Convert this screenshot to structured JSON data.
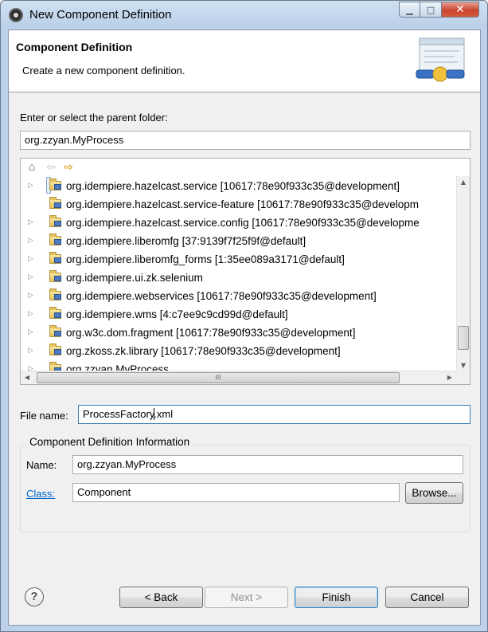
{
  "window": {
    "title": "New Component Definition"
  },
  "banner": {
    "title": "Component Definition",
    "description": "Create a new component definition."
  },
  "parent_folder": {
    "label": "Enter or select the parent folder:",
    "value": "org.zzyan.MyProcess"
  },
  "tree": {
    "items": [
      {
        "label": "org.idempiere.hazelcast.service [10617:78e90f933c35@development]",
        "expandable": true,
        "selected": true
      },
      {
        "label": "org.idempiere.hazelcast.service-feature [10617:78e90f933c35@developm",
        "expandable": false,
        "selected": false
      },
      {
        "label": "org.idempiere.hazelcast.service.config [10617:78e90f933c35@developme",
        "expandable": true,
        "selected": false
      },
      {
        "label": "org.idempiere.liberomfg [37:9139f7f25f9f@default]",
        "expandable": true,
        "selected": false
      },
      {
        "label": "org.idempiere.liberomfg_forms [1:35ee089a3171@default]",
        "expandable": true,
        "selected": false
      },
      {
        "label": "org.idempiere.ui.zk.selenium",
        "expandable": true,
        "selected": false
      },
      {
        "label": "org.idempiere.webservices [10617:78e90f933c35@development]",
        "expandable": true,
        "selected": false
      },
      {
        "label": "org.idempiere.wms [4:c7ee9c9cd99d@default]",
        "expandable": true,
        "selected": false
      },
      {
        "label": "org.w3c.dom.fragment [10617:78e90f933c35@development]",
        "expandable": true,
        "selected": false
      },
      {
        "label": "org.zkoss.zk.library [10617:78e90f933c35@development]",
        "expandable": true,
        "selected": false
      },
      {
        "label": "org.zzyan.MyProcess",
        "expandable": true,
        "selected": false
      }
    ],
    "hscroll_grip": "III"
  },
  "file_name": {
    "label": "File name:",
    "value_before_caret": "ProcessFactory",
    "value_after_caret": ".xml"
  },
  "info_group": {
    "title": "Component Definition Information",
    "name_label": "Name:",
    "name_value": "org.zzyan.MyProcess",
    "class_label": "Class:",
    "class_value": "Component",
    "browse_label": "Browse..."
  },
  "buttons": {
    "help": "?",
    "back": "< Back",
    "next": "Next >",
    "finish": "Finish",
    "cancel": "Cancel"
  },
  "icons": [
    "app-icon",
    "minimize-icon",
    "maximize-icon",
    "close-icon",
    "home-icon",
    "back-arrow-icon",
    "forward-arrow-icon",
    "folder-icon",
    "help-icon"
  ]
}
